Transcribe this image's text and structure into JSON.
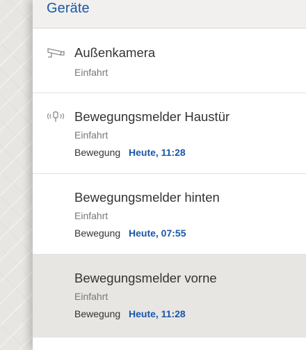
{
  "header": {
    "title": "Geräte"
  },
  "devices": [
    {
      "name": "Außenkamera",
      "location": "Einfahrt",
      "icon": "camera-icon"
    },
    {
      "name": "Bewegungsmelder Haustür",
      "location": "Einfahrt",
      "event_label": "Bewegung",
      "event_time": "Heute, 11:28",
      "icon": "motion-sensor-icon"
    },
    {
      "name": "Bewegungsmelder hinten",
      "location": "Einfahrt",
      "event_label": "Bewegung",
      "event_time": "Heute, 07:55"
    },
    {
      "name": "Bewegungsmelder vorne",
      "location": "Einfahrt",
      "event_label": "Bewegung",
      "event_time": "Heute, 11:28",
      "selected": true
    }
  ],
  "colors": {
    "accent": "#1a56a8",
    "selected_bg": "#e7e6e3",
    "text": "#333333",
    "muted": "#777777"
  }
}
